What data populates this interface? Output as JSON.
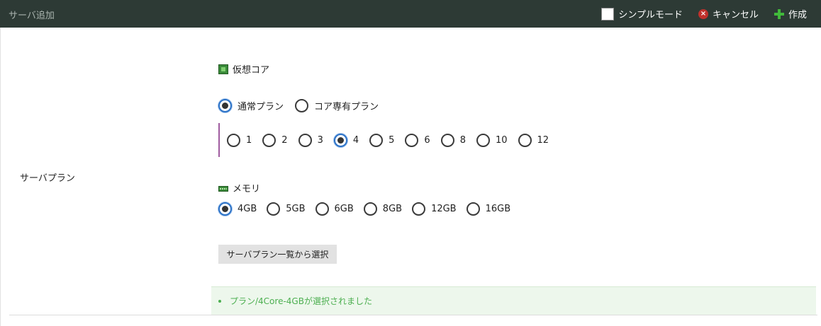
{
  "header": {
    "title": "サーバ追加",
    "simple_mode_label": "シンプルモード",
    "cancel_label": "キャンセル",
    "create_label": "作成"
  },
  "form": {
    "row_label": "サーバプラン",
    "cores": {
      "section_title": "仮想コア",
      "plan_types": [
        {
          "label": "通常プラン",
          "selected": true
        },
        {
          "label": "コア専有プラン",
          "selected": false
        }
      ],
      "options": [
        {
          "label": "1",
          "selected": false
        },
        {
          "label": "2",
          "selected": false
        },
        {
          "label": "3",
          "selected": false
        },
        {
          "label": "4",
          "selected": true
        },
        {
          "label": "5",
          "selected": false
        },
        {
          "label": "6",
          "selected": false
        },
        {
          "label": "8",
          "selected": false
        },
        {
          "label": "10",
          "selected": false
        },
        {
          "label": "12",
          "selected": false
        }
      ]
    },
    "memory": {
      "section_title": "メモリ",
      "options": [
        {
          "label": "4GB",
          "selected": true
        },
        {
          "label": "5GB",
          "selected": false
        },
        {
          "label": "6GB",
          "selected": false
        },
        {
          "label": "8GB",
          "selected": false
        },
        {
          "label": "12GB",
          "selected": false
        },
        {
          "label": "16GB",
          "selected": false
        }
      ]
    },
    "select_from_list_button": "サーバプラン一覧から選択",
    "notice": "プラン/4Core-4GBが選択されました"
  },
  "colors": {
    "header_bg": "#2d3a35",
    "accent_radio": "#2d73c8",
    "notice_text": "#4caf50",
    "notice_bg": "#edf7ec"
  },
  "icons": [
    "chip-icon",
    "memory-icon",
    "cancel-icon",
    "plus-icon",
    "checkbox-icon"
  ]
}
